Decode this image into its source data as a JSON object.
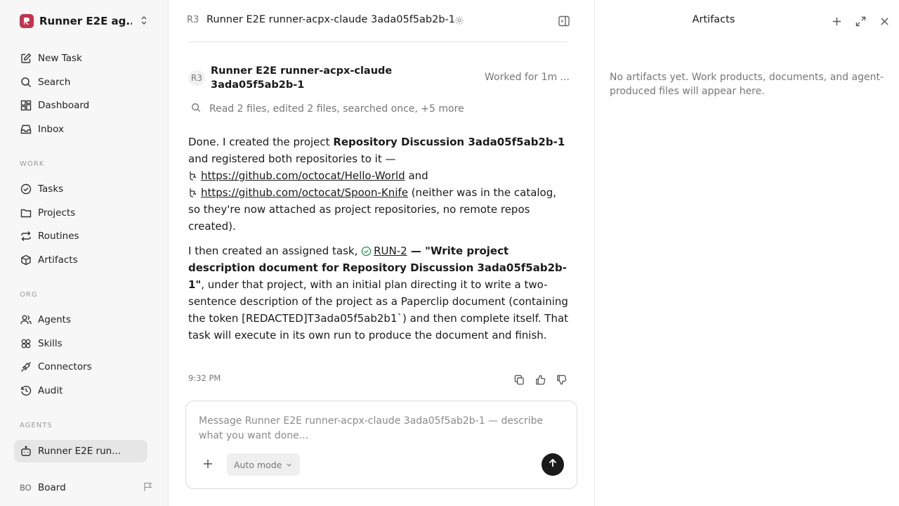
{
  "workspace": {
    "name": "Runner E2E ag..."
  },
  "sidebar": {
    "top_items": [
      {
        "label": "New Task"
      },
      {
        "label": "Search"
      },
      {
        "label": "Dashboard"
      },
      {
        "label": "Inbox"
      }
    ],
    "work_label": "WORK",
    "work_items": [
      {
        "label": "Tasks"
      },
      {
        "label": "Projects"
      },
      {
        "label": "Routines"
      },
      {
        "label": "Artifacts"
      }
    ],
    "org_label": "ORG",
    "org_items": [
      {
        "label": "Agents"
      },
      {
        "label": "Skills"
      },
      {
        "label": "Connectors"
      },
      {
        "label": "Audit"
      }
    ],
    "agents_label": "AGENTS",
    "agent_items": [
      {
        "label": "Runner E2E run..."
      }
    ],
    "board": {
      "initials": "BO",
      "label": "Board"
    }
  },
  "header": {
    "avatar": "R3",
    "title": "Runner E2E runner-acpx-claude 3ada05f5ab2b-1"
  },
  "message": {
    "avatar": "R3",
    "author": "Runner E2E runner-acpx-claude 3ada05f5ab2b-1",
    "worked": "Worked for 1m ...",
    "tool_summary": "Read 2 files, edited 2 files, searched once, +5 more",
    "p1_a": "Done. I created the project ",
    "p1_project": "Repository Discussion 3ada05f5ab2b-1",
    "p1_b": " and registered both repositories to it — ",
    "repo1": "https://github.com/octocat/Hello-World",
    "p1_and": " and ",
    "repo2": "https://github.com/octocat/Spoon-Knife",
    "p1_c": " (neither was in the catalog, so they're now attached as project repositories, no remote repos created).",
    "p2_a": "I then created an assigned task, ",
    "task_id": "RUN-2",
    "task_title": " — \"Write project description document for Repository Discussion 3ada05f5ab2b-1\"",
    "p2_b": ", under that project, with an initial plan directing it to write a two-sentence description of the project as a Paperclip document (containing the token [REDACTED]T3ada05f5ab2b1`) and then complete itself. That task will execute in its own run to produce the document and finish.",
    "timestamp": "9:32 PM"
  },
  "composer": {
    "placeholder": "Message Runner E2E runner-acpx-claude 3ada05f5ab2b-1 — describe what you want done...",
    "mode_label": "Auto mode"
  },
  "artifacts_panel": {
    "title": "Artifacts",
    "empty_text": "No artifacts yet. Work products, documents, and agent-produced files will appear here."
  },
  "colors": {
    "brand": "#c2334d",
    "sidebar_bg": "#f7f7f7",
    "active_item_bg": "#e6e6e6",
    "task_check": "#2e9e5b",
    "send_button": "#1a1a1a"
  }
}
